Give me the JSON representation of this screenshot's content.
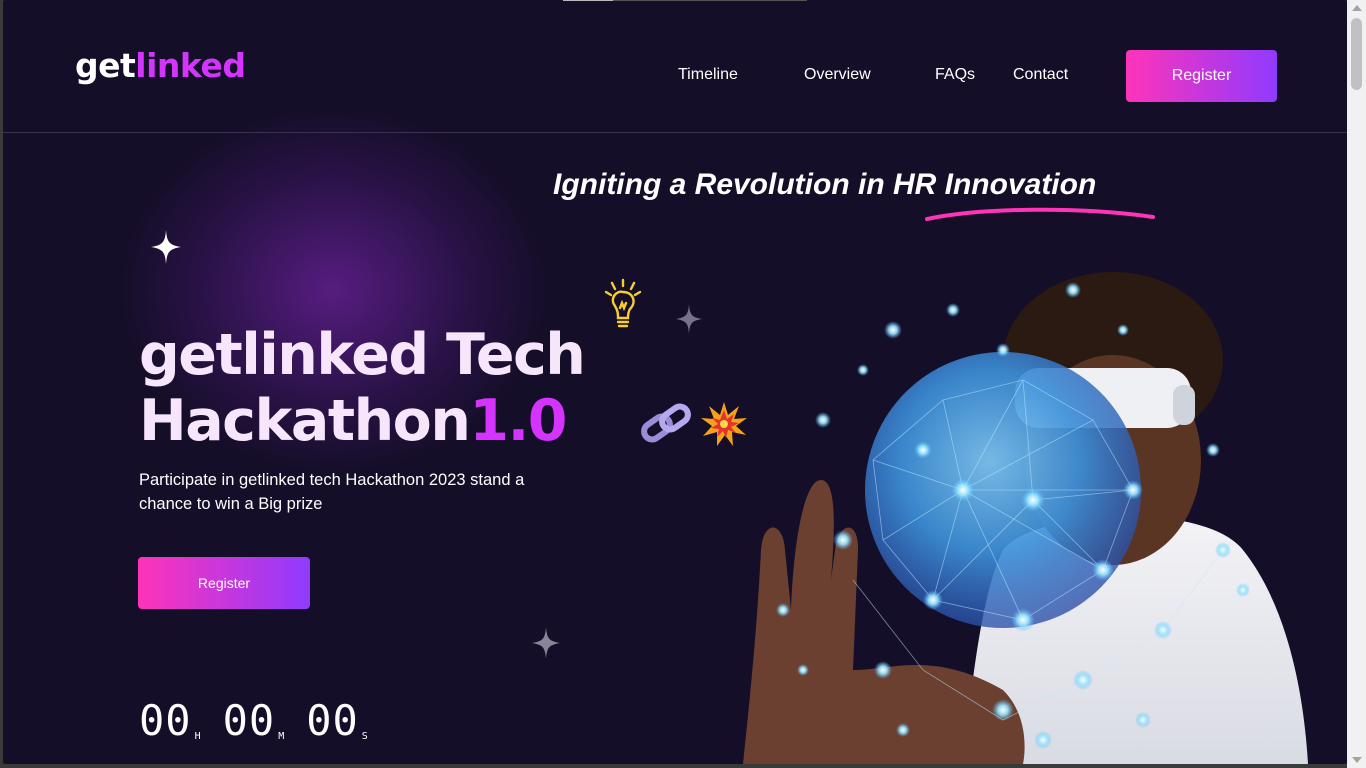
{
  "header": {
    "logo_part1": "get",
    "logo_part2": "linked",
    "nav": [
      "Timeline",
      "Overview",
      "FAQs",
      "Contact"
    ],
    "register_label": "Register"
  },
  "hero": {
    "tagline": "Igniting a Revolution in HR Innovation",
    "title_line1": "getlinked Tech",
    "title_line2": "Hackathon",
    "version": "1.0",
    "description": "Participate in getlinked tech Hackathon 2023 stand a chance to win a Big prize",
    "register_label": "Register"
  },
  "countdown": {
    "hours": "00",
    "hours_unit": "H",
    "minutes": "00",
    "minutes_unit": "M",
    "seconds": "00",
    "seconds_unit": "S"
  },
  "icons": [
    "sparkle-icon",
    "lightbulb-icon",
    "chain-link-icon",
    "explosion-icon"
  ],
  "colors": {
    "background": "#150e28",
    "accent": "#d434fe",
    "gradient_start": "#fe34b9",
    "gradient_end": "#903aff"
  }
}
